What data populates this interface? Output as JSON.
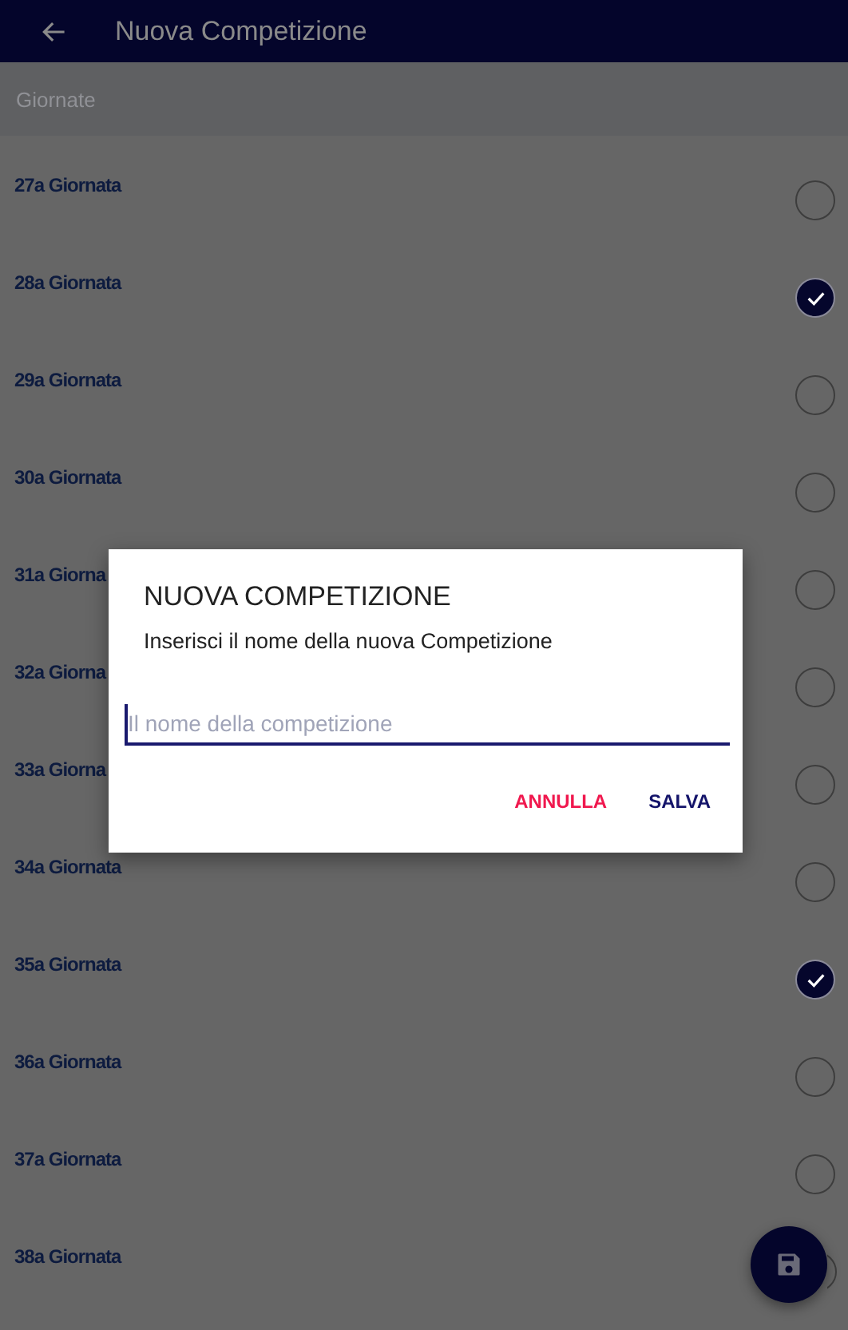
{
  "app_bar": {
    "title": "Nuova Competizione"
  },
  "section_header": "Giornate",
  "rows": [
    {
      "label": "27a Giornata",
      "checked": false
    },
    {
      "label": "28a Giornata",
      "checked": true
    },
    {
      "label": "29a Giornata",
      "checked": false
    },
    {
      "label": "30a Giornata",
      "checked": false
    },
    {
      "label": "31a Giorna",
      "checked": false
    },
    {
      "label": "32a Giorna",
      "checked": false
    },
    {
      "label": "33a Giorna",
      "checked": false
    },
    {
      "label": "34a Giornata",
      "checked": false
    },
    {
      "label": "35a Giornata",
      "checked": true
    },
    {
      "label": "36a Giornata",
      "checked": false
    },
    {
      "label": "37a Giornata",
      "checked": false
    },
    {
      "label": "38a Giornata",
      "checked": false
    }
  ],
  "dialog": {
    "title": "NUOVA COMPETIZIONE",
    "message": "Inserisci il nome della nuova Competizione",
    "input": {
      "placeholder": "Il nome della competizione"
    },
    "buttons": [
      {
        "label": "ANNULLA",
        "kind": "cancel"
      },
      {
        "label": "SALVA",
        "kind": "confirm"
      }
    ]
  }
}
